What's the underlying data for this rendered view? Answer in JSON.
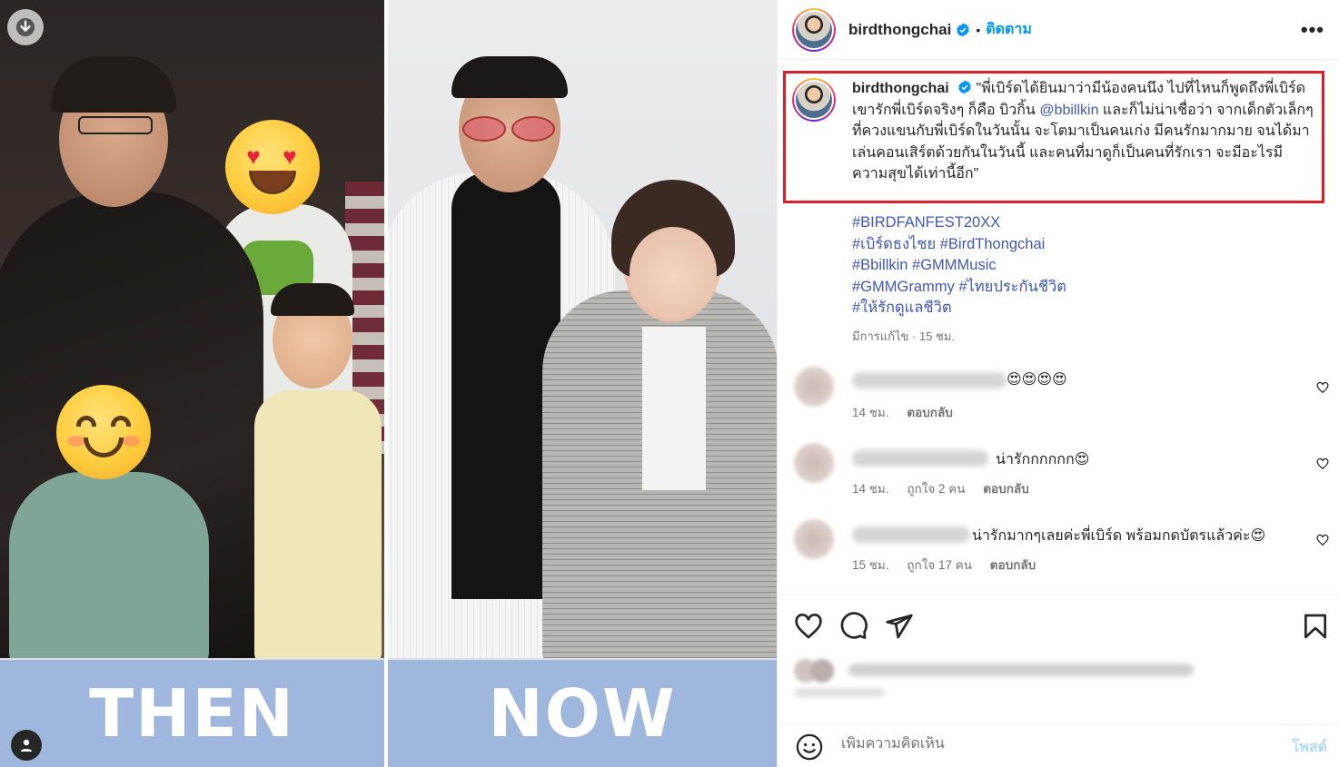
{
  "media": {
    "then_label": "THEN",
    "now_label": "NOW",
    "download_icon": "download-arrow-icon",
    "tagged_icon": "user-tag-icon"
  },
  "post": {
    "username": "birdthongchai",
    "follow_label": "ติดตาม",
    "more_icon": "•••",
    "caption": {
      "username": "birdthongchai",
      "part1": "\"พี่เบิร์ดได้ยินมาว่ามีน้องคนนึง ไปที่ไหนก็พูดถึงพี่เบิร์ด เขารักพี่เบิร์ดจริงๆ ก็คือ บิวกิ้น ",
      "mention": "@bbillkin",
      "part2": " และก็ไม่น่าเชื่อว่า จากเด็กตัวเล็กๆ ที่ควงแขนกับพี่เบิร์ดในวันนั้น จะโตมาเป็นคนเก่ง มีคนรักมากมาย จนได้มาเล่นคอนเสิร์ตด้วยกันในวันนี้ และคนที่มาดูก็เป็นคนที่รักเรา จะมีอะไรมีความสุขได้เท่านี้อีก\""
    },
    "hashtags": [
      "#BIRDFANFEST20XX",
      "#เบิร์ดธงไชย #BirdThongchai",
      "#Bbillkin #GMMMusic",
      "#GMMGrammy #ไทยประกันชีวิต",
      "#ให้รักดูแลชีวิต"
    ],
    "edited": "มีการแก้ไข · 15 ชม."
  },
  "comments": [
    {
      "text": "😍😍😍😍",
      "time": "14 ชม.",
      "likes": "",
      "reply": "ตอบกลับ"
    },
    {
      "text": "น่ารักกกกกก😍",
      "time": "14 ชม.",
      "likes": "ถูกใจ 2 คน",
      "reply": "ตอบกลับ"
    },
    {
      "text": "น่ารักมากๆเลยค่ะพี่เบิร์ด พร้อมกดบัตรแล้วค่ะ😍",
      "time": "15 ชม.",
      "likes": "ถูกใจ 17 คน",
      "reply": "ตอบกลับ"
    }
  ],
  "actions": {
    "like_icon": "heart-icon",
    "comment_icon": "comment-bubble-icon",
    "share_icon": "send-icon",
    "save_icon": "bookmark-icon"
  },
  "add_comment": {
    "placeholder": "เพิ่มความคิดเห็น",
    "post_label": "โพสต์"
  }
}
